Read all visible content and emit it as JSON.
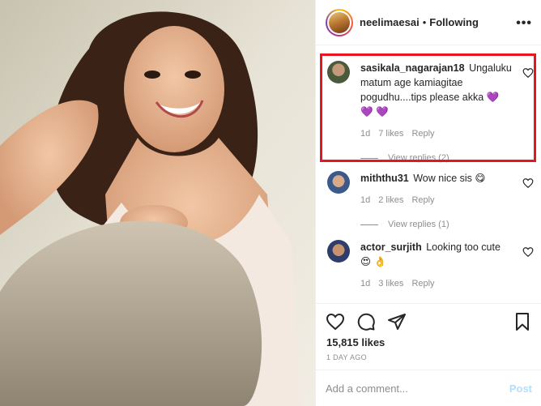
{
  "post": {
    "username": "neelimaesai",
    "separator": "•",
    "follow_status": "Following",
    "more_label": "•••"
  },
  "comments": [
    {
      "username": "sasikala_nagarajan18",
      "text": "Ungaluku matum age kamiagitae pogudhu....tips please akka",
      "emoji": "💜 💜 💜",
      "time": "1d",
      "likes": "7 likes",
      "reply": "Reply",
      "view_replies": "View replies (2)",
      "avatar_color": "#4a5a3a"
    },
    {
      "username": "miththu31",
      "text": "Wow nice sis",
      "emoji": "😋",
      "time": "1d",
      "likes": "2 likes",
      "reply": "Reply",
      "view_replies": "View replies (1)",
      "avatar_color": "#3b5a8a"
    },
    {
      "username": "actor_surjith",
      "text": "Looking too cute",
      "emoji": "😍 👌",
      "time": "1d",
      "likes": "3 likes",
      "reply": "Reply",
      "avatar_color": "#2f3d6b"
    }
  ],
  "footer": {
    "likes": "15,815 likes",
    "time_ago": "1 DAY AGO",
    "comment_placeholder": "Add a comment...",
    "post_label": "Post"
  },
  "colors": {
    "highlight": "#e8151e",
    "meta_text": "#8e8e8e",
    "post_button": "#b2dffc"
  }
}
